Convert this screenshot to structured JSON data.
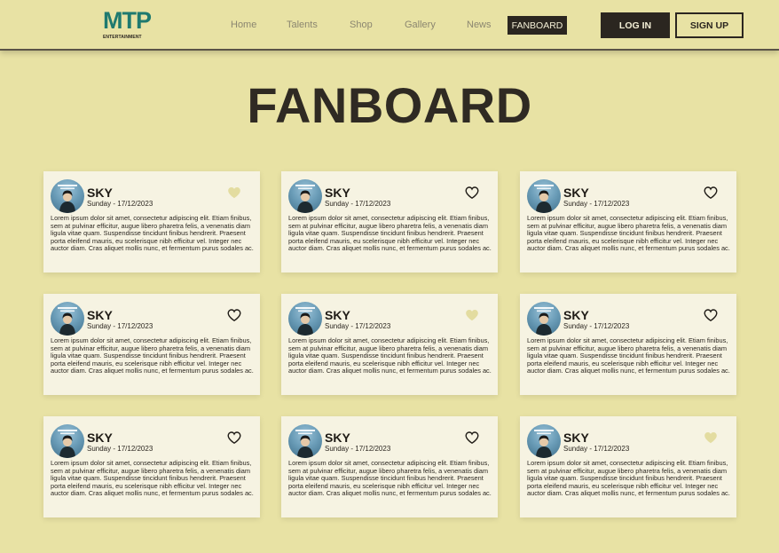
{
  "brand": {
    "logo_text": "MTP",
    "logo_sub": "ENTERTAINMENT"
  },
  "nav": {
    "links": [
      "Home",
      "Talents",
      "Shop",
      "Gallery",
      "News"
    ],
    "active": "FANBOARD",
    "login": "LOG IN",
    "signup": "SIGN UP"
  },
  "page": {
    "title": "FANBOARD"
  },
  "colors": {
    "background": "#e8e2a4",
    "card": "#f6f3e2",
    "dark": "#2b2620",
    "heart_liked": "#e3dca0",
    "logo": "#1f7a6f"
  },
  "posts": [
    {
      "name": "SKY",
      "date": "Sunday - 17/12/2023",
      "liked": true,
      "text": "Lorem ipsum dolor sit amet, consectetur adipiscing elit. Etiam finibus, sem at pulvinar efficitur, augue libero pharetra felis, a venenatis diam ligula vitae quam. Suspendisse tincidunt finibus hendrerit. Praesent porta eleifend mauris, eu scelerisque nibh efficitur vel. Integer nec auctor diam. Cras aliquet mollis nunc, et fermentum purus sodales ac."
    },
    {
      "name": "SKY",
      "date": "Sunday - 17/12/2023",
      "liked": false,
      "text": "Lorem ipsum dolor sit amet, consectetur adipiscing elit. Etiam finibus, sem at pulvinar efficitur, augue libero pharetra felis, a venenatis diam ligula vitae quam. Suspendisse tincidunt finibus hendrerit. Praesent porta eleifend mauris, eu scelerisque nibh efficitur vel. Integer nec auctor diam. Cras aliquet mollis nunc, et fermentum purus sodales ac."
    },
    {
      "name": "SKY",
      "date": "Sunday - 17/12/2023",
      "liked": false,
      "text": "Lorem ipsum dolor sit amet, consectetur adipiscing elit. Etiam finibus, sem at pulvinar efficitur, augue libero pharetra felis, a venenatis diam ligula vitae quam. Suspendisse tincidunt finibus hendrerit. Praesent porta eleifend mauris, eu scelerisque nibh efficitur vel. Integer nec auctor diam. Cras aliquet mollis nunc, et fermentum purus sodales ac."
    },
    {
      "name": "SKY",
      "date": "Sunday - 17/12/2023",
      "liked": false,
      "text": "Lorem ipsum dolor sit amet, consectetur adipiscing elit. Etiam finibus, sem at pulvinar efficitur, augue libero pharetra felis, a venenatis diam ligula vitae quam. Suspendisse tincidunt finibus hendrerit. Praesent porta eleifend mauris, eu scelerisque nibh efficitur vel. Integer nec auctor diam. Cras aliquet mollis nunc, et fermentum purus sodales ac."
    },
    {
      "name": "SKY",
      "date": "Sunday - 17/12/2023",
      "liked": true,
      "text": "Lorem ipsum dolor sit amet, consectetur adipiscing elit. Etiam finibus, sem at pulvinar efficitur, augue libero pharetra felis, a venenatis diam ligula vitae quam. Suspendisse tincidunt finibus hendrerit. Praesent porta eleifend mauris, eu scelerisque nibh efficitur vel. Integer nec auctor diam. Cras aliquet mollis nunc, et fermentum purus sodales ac."
    },
    {
      "name": "SKY",
      "date": "Sunday - 17/12/2023",
      "liked": false,
      "text": "Lorem ipsum dolor sit amet, consectetur adipiscing elit. Etiam finibus, sem at pulvinar efficitur, augue libero pharetra felis, a venenatis diam ligula vitae quam. Suspendisse tincidunt finibus hendrerit. Praesent porta eleifend mauris, eu scelerisque nibh efficitur vel. Integer nec auctor diam. Cras aliquet mollis nunc, et fermentum purus sodales ac."
    },
    {
      "name": "SKY",
      "date": "Sunday - 17/12/2023",
      "liked": false,
      "text": "Lorem ipsum dolor sit amet, consectetur adipiscing elit. Etiam finibus, sem at pulvinar efficitur, augue libero pharetra felis, a venenatis diam ligula vitae quam. Suspendisse tincidunt finibus hendrerit. Praesent porta eleifend mauris, eu scelerisque nibh efficitur vel. Integer nec auctor diam. Cras aliquet mollis nunc, et fermentum purus sodales ac."
    },
    {
      "name": "SKY",
      "date": "Sunday - 17/12/2023",
      "liked": false,
      "text": "Lorem ipsum dolor sit amet, consectetur adipiscing elit. Etiam finibus, sem at pulvinar efficitur, augue libero pharetra felis, a venenatis diam ligula vitae quam. Suspendisse tincidunt finibus hendrerit. Praesent porta eleifend mauris, eu scelerisque nibh efficitur vel. Integer nec auctor diam. Cras aliquet mollis nunc, et fermentum purus sodales ac."
    },
    {
      "name": "SKY",
      "date": "Sunday - 17/12/2023",
      "liked": true,
      "text": "Lorem ipsum dolor sit amet, consectetur adipiscing elit. Etiam finibus, sem at pulvinar efficitur, augue libero pharetra felis, a venenatis diam ligula vitae quam. Suspendisse tincidunt finibus hendrerit. Praesent porta eleifend mauris, eu scelerisque nibh efficitur vel. Integer nec auctor diam. Cras aliquet mollis nunc, et fermentum purus sodales ac."
    }
  ]
}
